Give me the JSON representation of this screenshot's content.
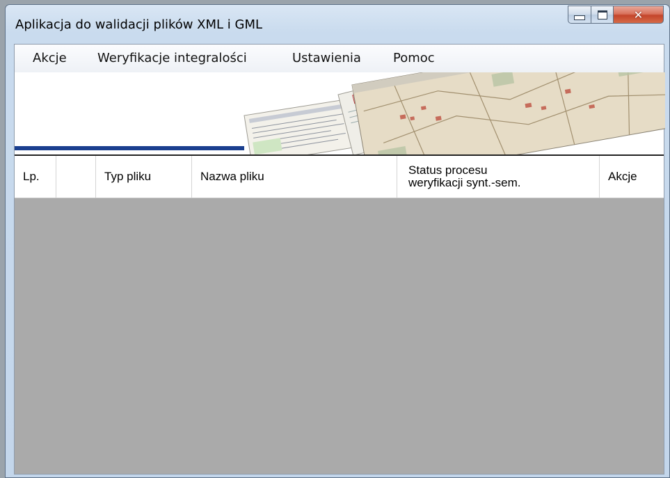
{
  "window": {
    "title": "Aplikacja do walidacji plików XML i GML",
    "close_glyph": "✕"
  },
  "menu": {
    "items": [
      "Akcje",
      "Weryfikacje integralości",
      "Ustawienia",
      "Pomoc"
    ]
  },
  "grid": {
    "columns": [
      {
        "label": "Lp."
      },
      {
        "label": ""
      },
      {
        "label": "Typ pliku"
      },
      {
        "label": "Nazwa pliku"
      },
      {
        "label_line1": "Status procesu",
        "label_line2": "weryfikacji synt.-sem."
      },
      {
        "label": "Akcje"
      }
    ],
    "rows": []
  },
  "colors": {
    "banner_line": "#1a3f8f",
    "grid_background": "#aaaaaa",
    "close_button": "#c4452b"
  }
}
